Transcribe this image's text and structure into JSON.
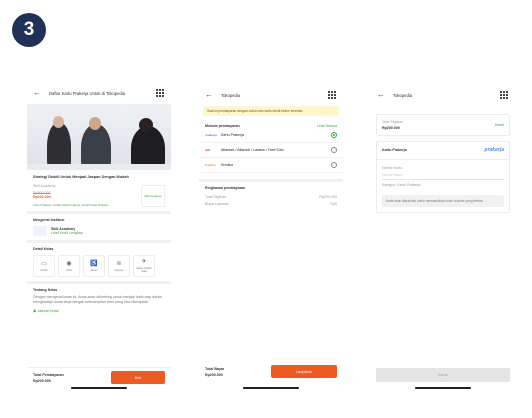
{
  "step_number": "3",
  "screen1": {
    "header_title": "Daftar Kartu Prakerja Untuk di Tokopedia",
    "course_title": "Strategi Diskill Untuk Menjadi Jaspan Dengan Mudah",
    "provider": "Skill Academy",
    "original_price": "Rp000.000",
    "price": "Rp200.000",
    "badge_text": "Skill Academy",
    "breadcrumb": "Kartu Prakerja › Daftar Kelas Prakerja › Detail Kelas Prakerja",
    "institution_heading": "Mengenal Institusi",
    "institution_name": "Skill Academy",
    "institution_link": "Lihat Profil Lengkap",
    "class_detail_heading": "Detail Kelas",
    "features": [
      {
        "icon": "monitor-icon",
        "glyph": "▭",
        "label": "Online"
      },
      {
        "icon": "video-icon",
        "glyph": "◉",
        "label": "Video"
      },
      {
        "icon": "accessibility-icon",
        "glyph": "♿",
        "label": "Akses"
      },
      {
        "icon": "wifi-icon",
        "glyph": "≋",
        "label": "Internet"
      },
      {
        "icon": "plane-icon",
        "glyph": "✈",
        "label": "Akses Kapan Saja"
      }
    ],
    "about_heading": "Tentang Kelas",
    "about_text": "Dengan mengenal kelas ini, Anda akan dibimbing untuk menjadi lebih siap dalam menghadapi dunia kerja dengan keterampilan baru yang bisa diterapkan.",
    "schedule_link": "Jadwal Kelas",
    "total_label": "Total Pembayaran",
    "total_value": "Rp200.000",
    "buy_button": "Beli"
  },
  "screen2": {
    "header_title": "Tokopedia",
    "notice": "Saat ini pembayaran dengan cicilan dan kartu kredit belum tersedia.",
    "methods_heading": "Metode pembayaran",
    "see_all": "Lihat Semua",
    "methods": [
      {
        "logo": "prakerja",
        "name": "Kartu Prakerja",
        "selected": true
      },
      {
        "logo": "alfa",
        "name": "Alfamart / Alfamidi / Lawson / Dan+Dan",
        "selected": false
      },
      {
        "logo": "kredivo",
        "name": "Kredivo",
        "selected": false
      }
    ],
    "summary_heading": "Ringkasan pembayaran",
    "bill_label": "Total Tagihan",
    "bill_value": "Rp200.000",
    "fee_label": "Biaya Layanan",
    "fee_value": "Rp0",
    "pay_label": "Total Bayar",
    "pay_value": "Rp200.000",
    "continue_button": "Lanjutkan"
  },
  "screen3": {
    "header_title": "Tokopedia",
    "bill_label": "Total Tagihan",
    "bill_value": "Rp200.000",
    "detail_link": "Detail",
    "card_title": "Kartu Prakerja",
    "prakerja_logo": "prakerja",
    "field_label": "Nomor Kartu",
    "field_value": "Nomor Kartu",
    "category_label": "Kategori: Kartu Prakerja",
    "hint": "Anda akan diarahkan untuk memasukkan kode voucher yang tertera.",
    "pay_button": "Bayar"
  }
}
